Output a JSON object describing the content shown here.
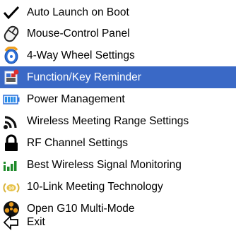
{
  "menu": {
    "items": [
      {
        "label": "Auto Launch on Boot",
        "icon": "checkmark-icon",
        "selected": false
      },
      {
        "label": "Mouse-Control Panel",
        "icon": "mouse-icon",
        "selected": false
      },
      {
        "label": "4-Way Wheel Settings",
        "icon": "wheel-icon",
        "selected": false
      },
      {
        "label": "Function/Key Reminder",
        "icon": "key-reminder-icon",
        "selected": true
      },
      {
        "label": "Power Management",
        "icon": "battery-icon",
        "selected": false
      },
      {
        "label": "Wireless Meeting Range Settings",
        "icon": "wireless-range-icon",
        "selected": false
      },
      {
        "label": "RF Channel Settings",
        "icon": "lock-icon",
        "selected": false
      },
      {
        "label": "Best Wireless Signal Monitoring",
        "icon": "signal-bars-icon",
        "selected": false
      },
      {
        "label": "10-Link Meeting Technology",
        "icon": "link-badge-icon",
        "selected": false
      },
      {
        "label": "Open G10 Multi-Mode",
        "icon": "multi-mode-icon",
        "selected": false
      },
      {
        "label": "Exit",
        "icon": "exit-arrow-icon",
        "selected": false
      }
    ]
  },
  "colors": {
    "selection_background": "#3a69c6",
    "selection_text": "#ffffff",
    "text": "#000000",
    "background": "#ffffff"
  }
}
